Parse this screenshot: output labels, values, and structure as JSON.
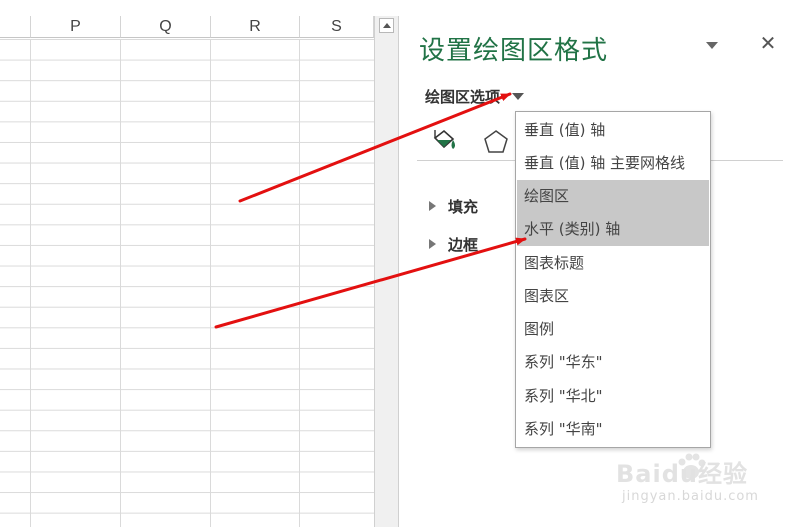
{
  "sheet": {
    "columns": [
      "",
      "P",
      "Q",
      "R",
      "S"
    ]
  },
  "pane": {
    "title": "设置绘图区格式",
    "options_label": "绘图区选项",
    "sections": [
      "填充",
      "边框"
    ]
  },
  "dropdown": {
    "items": [
      "垂直 (值) 轴",
      "垂直 (值) 轴 主要网格线",
      "绘图区",
      "水平 (类别) 轴",
      "图表标题",
      "图表区",
      "图例",
      "系列 \"华东\"",
      "系列 \"华北\"",
      "系列 \"华南\""
    ],
    "highlighted": [
      "绘图区",
      "水平 (类别) 轴"
    ]
  },
  "watermark": {
    "main": "Baidu经验",
    "sub": "jingyan.baidu.com"
  },
  "colors": {
    "title_green": "#217346",
    "arrow_red": "#e31010",
    "highlight_gray": "#c8c8c8"
  },
  "icons": [
    "pane-menu-chevron-icon",
    "close-icon",
    "fill-line-icon",
    "effects-pentagon-icon",
    "expand-triangle-icon",
    "scroll-up-icon"
  ]
}
